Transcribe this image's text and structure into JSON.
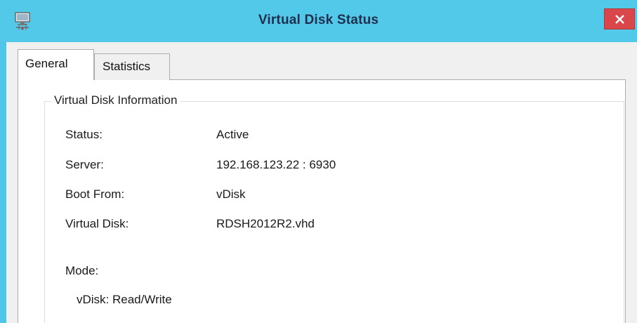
{
  "window": {
    "title": "Virtual Disk Status",
    "app_icon": "monitor-network-icon",
    "close_icon": "close-icon",
    "colors": {
      "titlebar": "#53c9ea",
      "close": "#d9474a",
      "client": "#f0f0f0"
    }
  },
  "tabs": [
    {
      "label": "General",
      "selected": true
    },
    {
      "label": "Statistics",
      "selected": false
    }
  ],
  "group": {
    "title": "Virtual Disk Information",
    "rows": [
      {
        "label": "Status:",
        "value": "Active"
      },
      {
        "label": "Server:",
        "value": "192.168.123.22 : 6930"
      },
      {
        "label": "Boot From:",
        "value": "vDisk"
      },
      {
        "label": "Virtual Disk:",
        "value": "RDSH2012R2.vhd"
      }
    ],
    "mode": {
      "label": "Mode:",
      "value": "vDisk: Read/Write"
    }
  }
}
